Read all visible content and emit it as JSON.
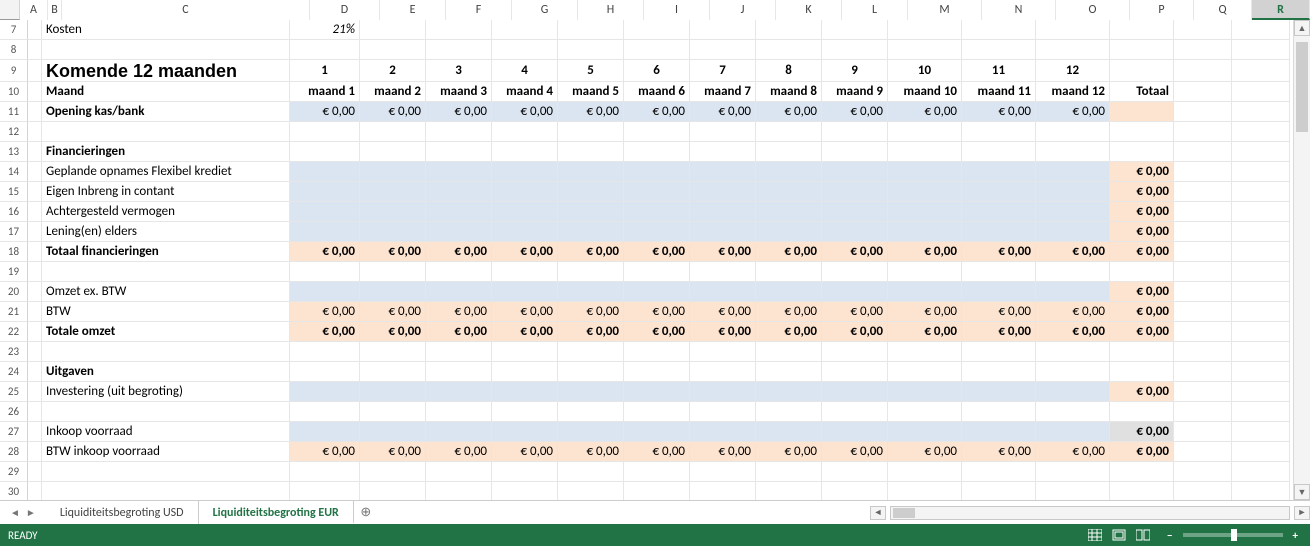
{
  "columns": [
    "A",
    "B",
    "C",
    "D",
    "E",
    "F",
    "G",
    "H",
    "I",
    "J",
    "K",
    "L",
    "M",
    "N",
    "O",
    "P",
    "Q",
    "R"
  ],
  "selectedColumn": "R",
  "rowNumbers": [
    7,
    8,
    9,
    10,
    11,
    12,
    13,
    14,
    15,
    16,
    17,
    18,
    19,
    20,
    21,
    22,
    23,
    24,
    25,
    26,
    27,
    28,
    29,
    30
  ],
  "topRow": {
    "label": "Kosten",
    "value": "21%"
  },
  "titleRow": {
    "title": "Komende 12 maanden",
    "months": [
      "1",
      "2",
      "3",
      "4",
      "5",
      "6",
      "7",
      "8",
      "9",
      "10",
      "11",
      "12"
    ]
  },
  "monthHeader": {
    "label": "Maand",
    "cells": [
      "maand 1",
      "maand 2",
      "maand 3",
      "maand 4",
      "maand 5",
      "maand 6",
      "maand 7",
      "maand 8",
      "maand 9",
      "maand 10",
      "maand 11",
      "maand 12"
    ],
    "totalLabel": "Totaal"
  },
  "opening": {
    "label": "Opening kas/bank",
    "values": [
      "€ 0,00",
      "€ 0,00",
      "€ 0,00",
      "€ 0,00",
      "€ 0,00",
      "€ 0,00",
      "€ 0,00",
      "€ 0,00",
      "€ 0,00",
      "€ 0,00",
      "€ 0,00",
      "€ 0,00"
    ]
  },
  "sections": {
    "fin": {
      "title": "Financieringen",
      "rows": [
        {
          "label": "Geplande opnames Flexibel krediet",
          "total": "€ 0,00"
        },
        {
          "label": "Eigen Inbreng in contant",
          "total": "€ 0,00"
        },
        {
          "label": "Achtergesteld vermogen",
          "total": "€ 0,00"
        },
        {
          "label": "Lening(en) elders",
          "total": "€ 0,00"
        }
      ],
      "totalRow": {
        "label": "Totaal financieringen",
        "values": [
          "€ 0,00",
          "€ 0,00",
          "€ 0,00",
          "€ 0,00",
          "€ 0,00",
          "€ 0,00",
          "€ 0,00",
          "€ 0,00",
          "€ 0,00",
          "€ 0,00",
          "€ 0,00",
          "€ 0,00"
        ],
        "total": "€ 0,00"
      }
    },
    "omzet": {
      "rows": [
        {
          "label": "Omzet ex. BTW",
          "total": "€ 0,00"
        },
        {
          "label": "BTW",
          "values": [
            "€ 0,00",
            "€ 0,00",
            "€ 0,00",
            "€ 0,00",
            "€ 0,00",
            "€ 0,00",
            "€ 0,00",
            "€ 0,00",
            "€ 0,00",
            "€ 0,00",
            "€ 0,00",
            "€ 0,00"
          ],
          "total": "€ 0,00"
        }
      ],
      "totalRow": {
        "label": "Totale omzet",
        "values": [
          "€ 0,00",
          "€ 0,00",
          "€ 0,00",
          "€ 0,00",
          "€ 0,00",
          "€ 0,00",
          "€ 0,00",
          "€ 0,00",
          "€ 0,00",
          "€ 0,00",
          "€ 0,00",
          "€ 0,00"
        ],
        "total": "€ 0,00"
      }
    },
    "uitgaven": {
      "title": "Uitgaven",
      "rows": [
        {
          "label": "Investering (uit begroting)",
          "total": "€ 0,00"
        },
        {
          "spacer": true
        },
        {
          "label": "Inkoop voorraad",
          "total": "€ 0,00",
          "gray": true
        },
        {
          "label": "BTW inkoop voorraad",
          "values": [
            "€ 0,00",
            "€ 0,00",
            "€ 0,00",
            "€ 0,00",
            "€ 0,00",
            "€ 0,00",
            "€ 0,00",
            "€ 0,00",
            "€ 0,00",
            "€ 0,00",
            "€ 0,00",
            "€ 0,00"
          ],
          "total": "€ 0,00"
        }
      ]
    }
  },
  "tabs": {
    "items": [
      "Liquiditeitsbegroting USD",
      "Liquiditeitsbegroting EUR"
    ],
    "activeIndex": 1
  },
  "status": {
    "left": "READY",
    "zoom": "100%"
  }
}
